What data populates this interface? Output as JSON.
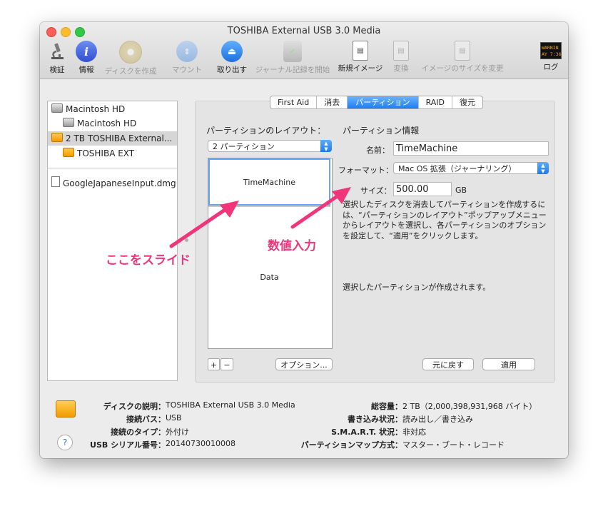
{
  "window": {
    "title": "TOSHIBA External USB 3.0 Media"
  },
  "toolbar": {
    "items": [
      {
        "label": "検証",
        "icon": "microscope-icon"
      },
      {
        "label": "情報",
        "icon": "info-icon"
      },
      {
        "label": "ディスクを作成",
        "icon": "burn-disc-icon"
      },
      {
        "label": "マウント",
        "icon": "mount-icon"
      },
      {
        "label": "取り出す",
        "icon": "eject-icon"
      },
      {
        "label": "ジャーナル記録を開始",
        "icon": "journal-icon"
      },
      {
        "label": "新規イメージ",
        "icon": "new-image-icon"
      },
      {
        "label": "変換",
        "icon": "convert-icon"
      },
      {
        "label": "イメージのサイズを変更",
        "icon": "resize-image-icon"
      },
      {
        "label": "ログ",
        "icon": "log-icon"
      }
    ],
    "log_badge": "WARNIN\nAY 7:36"
  },
  "sidebar": {
    "items": [
      {
        "label": "Macintosh HD"
      },
      {
        "label": "Macintosh HD"
      },
      {
        "label": "2 TB TOSHIBA External..."
      },
      {
        "label": "TOSHIBA EXT"
      },
      {
        "label": "GoogleJapaneseInput.dmg"
      }
    ]
  },
  "tabs": [
    "First Aid",
    "消去",
    "パーティション",
    "RAID",
    "復元"
  ],
  "partition": {
    "layout_heading": "パーティションのレイアウト：",
    "layout_value": "2 パーティション",
    "info_heading": "パーティション情報",
    "name_label": "名前：",
    "name_value": "TimeMachine",
    "format_label": "フォーマット：",
    "format_value": "Mac OS 拡張（ジャーナリング）",
    "size_label": "サイズ：",
    "size_value": "500.00",
    "size_unit": "GB",
    "description": "選択したディスクを消去してパーティションを作成するには、“パーティションのレイアウト”ポップアップメニューからレイアウトを選択し、各パーティションのオプションを設定して、“適用”をクリックします。",
    "status": "選択したパーティションが作成されます。",
    "parts": [
      "TimeMachine",
      "Data"
    ],
    "add_label": "+",
    "remove_label": "−",
    "options_label": "オプション...",
    "revert_label": "元に戻す",
    "apply_label": "適用"
  },
  "annotations": {
    "slide": "ここをスライド",
    "input": "数値入力",
    "color": "#f0357a"
  },
  "footer": {
    "rows_left": [
      {
        "label": "ディスクの説明：",
        "value": "TOSHIBA External USB 3.0 Media"
      },
      {
        "label": "接続バス：",
        "value": "USB"
      },
      {
        "label": "接続のタイプ：",
        "value": "外付け"
      },
      {
        "label": "USB シリアル番号：",
        "value": "20140730010008"
      }
    ],
    "rows_right": [
      {
        "label": "総容量：",
        "value": "2 TB（2,000,398,931,968 バイト）"
      },
      {
        "label": "書き込み状況：",
        "value": "読み出し／書き込み"
      },
      {
        "label": "S.M.A.R.T. 状況：",
        "value": "非対応"
      },
      {
        "label": "パーティションマップ方式：",
        "value": "マスター・ブート・レコード"
      }
    ],
    "help": "?"
  }
}
